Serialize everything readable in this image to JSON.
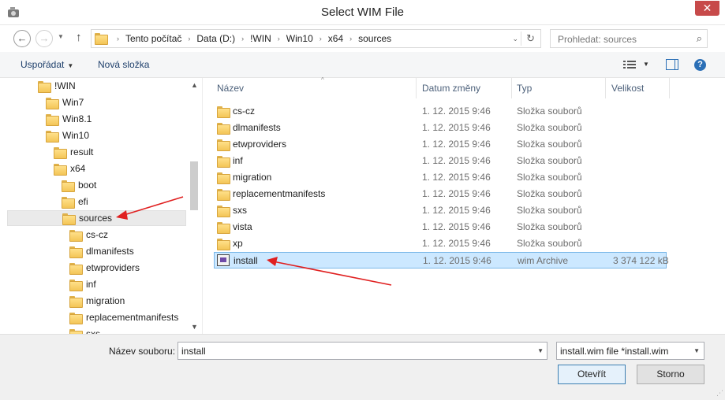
{
  "window": {
    "title": "Select WIM File",
    "close_glyph": "✕"
  },
  "nav": {
    "back_glyph": "←",
    "forward_glyph": "→",
    "dropdown_glyph": "▼",
    "up_glyph": "↑",
    "breadcrumb": [
      "Tento počítač",
      "Data (D:)",
      "!WIN",
      "Win10",
      "x64",
      "sources"
    ],
    "sep_glyph": "›",
    "addr_dropdown_glyph": "⌄",
    "refresh_glyph": "↻",
    "search_placeholder": "Prohledat: sources",
    "search_glyph": "⌕"
  },
  "toolbar": {
    "organize_label": "Uspořádat",
    "organize_caret": "▼",
    "new_folder_label": "Nová složka",
    "view_dropdown_glyph": "▼",
    "help_glyph": "?"
  },
  "tree": {
    "items": [
      {
        "label": "!WIN"
      },
      {
        "label": "Win7"
      },
      {
        "label": "Win8.1"
      },
      {
        "label": "Win10"
      },
      {
        "label": "result"
      },
      {
        "label": "x64"
      },
      {
        "label": "boot"
      },
      {
        "label": "efi"
      },
      {
        "label": "sources"
      },
      {
        "label": "cs-cz"
      },
      {
        "label": "dlmanifests"
      },
      {
        "label": "etwproviders"
      },
      {
        "label": "inf"
      },
      {
        "label": "migration"
      },
      {
        "label": "replacementmanifests"
      },
      {
        "label": "sxs"
      }
    ],
    "scroll_up_glyph": "▲",
    "scroll_down_glyph": "▼"
  },
  "list": {
    "columns": [
      "Název",
      "Datum změny",
      "Typ",
      "Velikost"
    ],
    "sort_glyph": "^",
    "rows": [
      {
        "name": "cs-cz",
        "date": "1. 12. 2015 9:46",
        "type": "Složka souborů",
        "size": ""
      },
      {
        "name": "dlmanifests",
        "date": "1. 12. 2015 9:46",
        "type": "Složka souborů",
        "size": ""
      },
      {
        "name": "etwproviders",
        "date": "1. 12. 2015 9:46",
        "type": "Složka souborů",
        "size": ""
      },
      {
        "name": "inf",
        "date": "1. 12. 2015 9:46",
        "type": "Složka souborů",
        "size": ""
      },
      {
        "name": "migration",
        "date": "1. 12. 2015 9:46",
        "type": "Složka souborů",
        "size": ""
      },
      {
        "name": "replacementmanifests",
        "date": "1. 12. 2015 9:46",
        "type": "Složka souborů",
        "size": ""
      },
      {
        "name": "sxs",
        "date": "1. 12. 2015 9:46",
        "type": "Složka souborů",
        "size": ""
      },
      {
        "name": "vista",
        "date": "1. 12. 2015 9:46",
        "type": "Složka souborů",
        "size": ""
      },
      {
        "name": "xp",
        "date": "1. 12. 2015 9:46",
        "type": "Složka souborů",
        "size": ""
      },
      {
        "name": "install",
        "date": "1. 12. 2015 9:46",
        "type": "wim Archive",
        "size": "3 374 122 kB"
      }
    ]
  },
  "footer": {
    "filename_label": "Název souboru:",
    "filename_value": "install",
    "filename_dd_glyph": "▼",
    "filetype_value": "install.wim file *install.wim",
    "filetype_dd_glyph": "▼",
    "open_label": "Otevřít",
    "cancel_label": "Storno",
    "grip_glyph": "⋰"
  },
  "colors": {
    "accent": "#2b6fb6",
    "selection": "#cce8ff",
    "annotation_arrow": "#e02020",
    "close_button": "#c74a4a"
  }
}
